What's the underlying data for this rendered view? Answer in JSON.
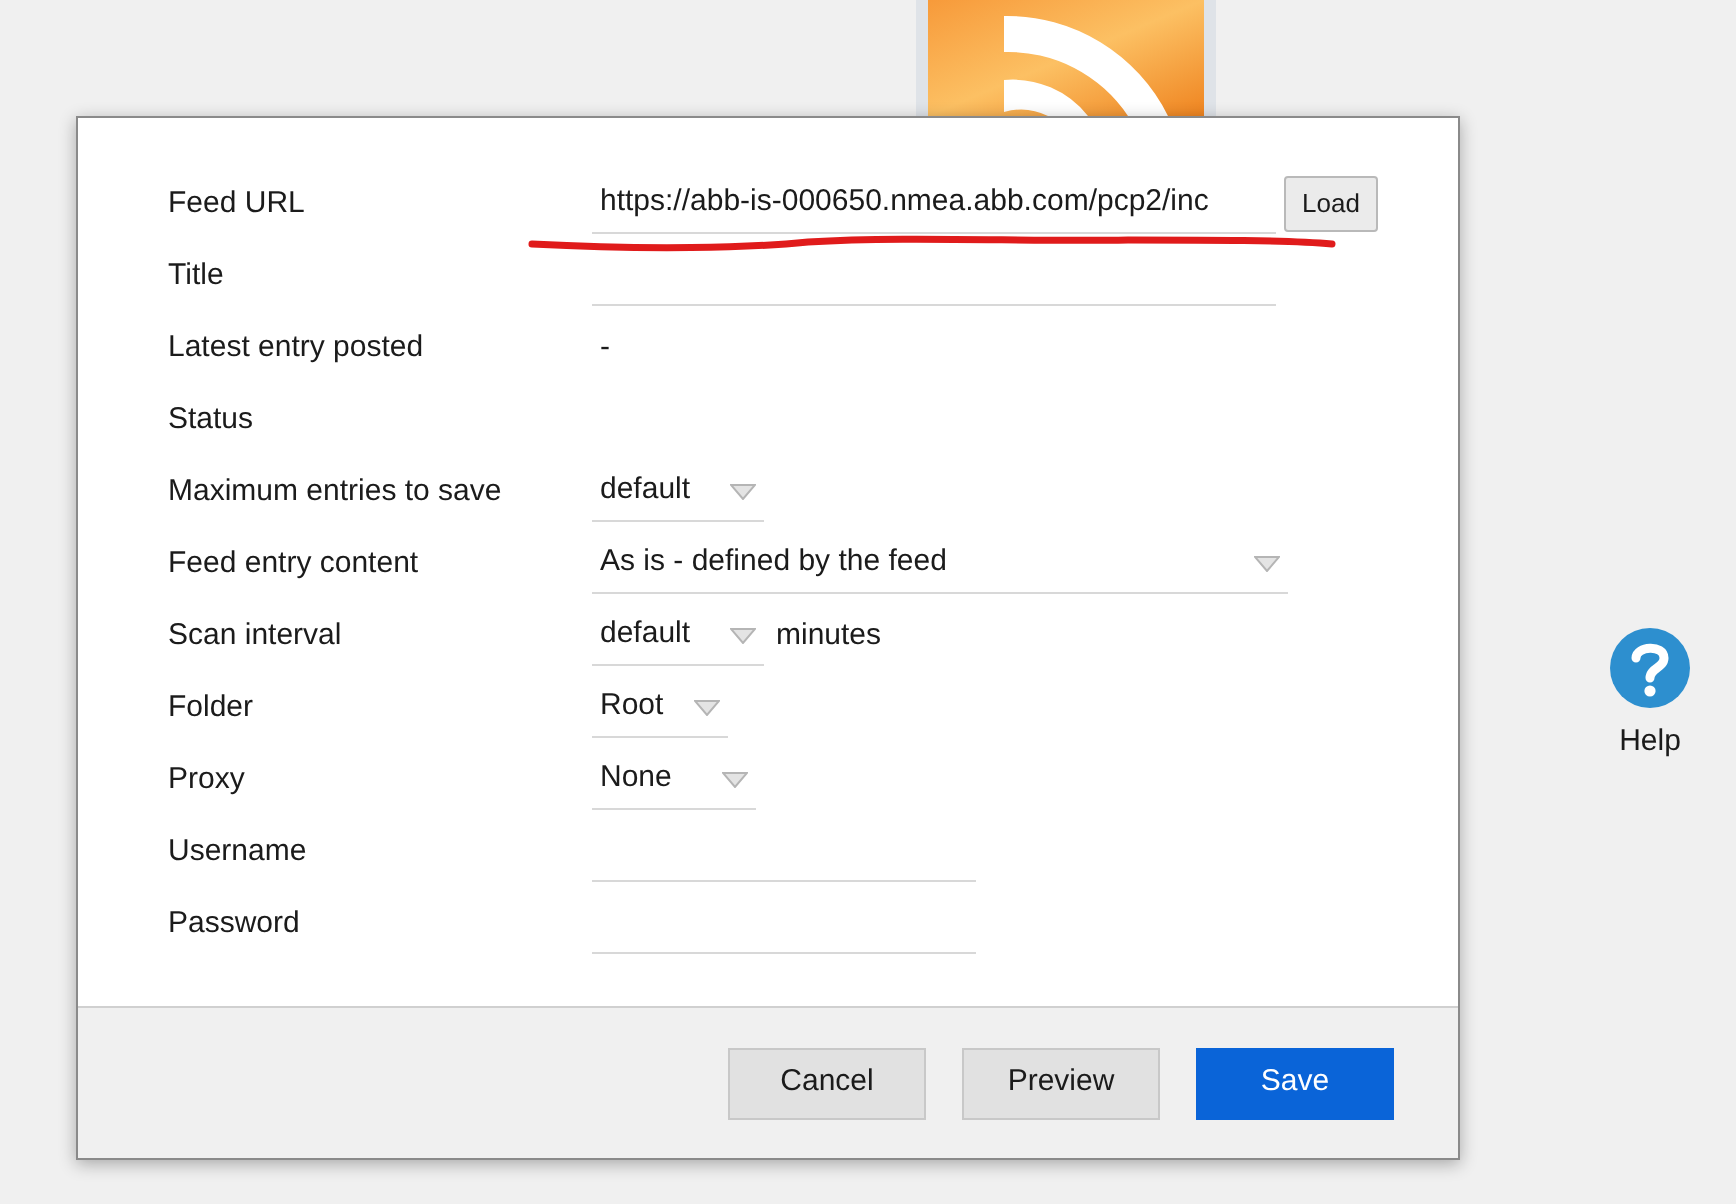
{
  "help": {
    "label": "Help"
  },
  "fields": [
    {
      "kind": "url",
      "label": "Feed URL",
      "value": "https://abb-is-000650.nmea.abb.com/pcp2/inc",
      "button": "Load",
      "underlined": true
    },
    {
      "kind": "text",
      "label": "Title"
    },
    {
      "kind": "readonly",
      "label": "Latest entry posted",
      "value": "-"
    },
    {
      "kind": "readonly",
      "label": "Status"
    },
    {
      "kind": "select",
      "label": "Maximum entries to save",
      "value": "default"
    },
    {
      "kind": "select",
      "label": "Feed entry content",
      "value": "As is - defined by the feed"
    },
    {
      "kind": "select",
      "label": "Scan interval",
      "value": "default",
      "suffix": "minutes"
    },
    {
      "kind": "select",
      "label": "Folder",
      "value": "Root"
    },
    {
      "kind": "select",
      "label": "Proxy",
      "value": "None"
    },
    {
      "kind": "text",
      "label": "Username"
    },
    {
      "kind": "password",
      "label": "Password"
    }
  ],
  "buttons": [
    {
      "label": "Cancel",
      "kind": "secondary"
    },
    {
      "label": "Preview",
      "kind": "secondary"
    },
    {
      "label": "Save",
      "kind": "primary"
    }
  ]
}
